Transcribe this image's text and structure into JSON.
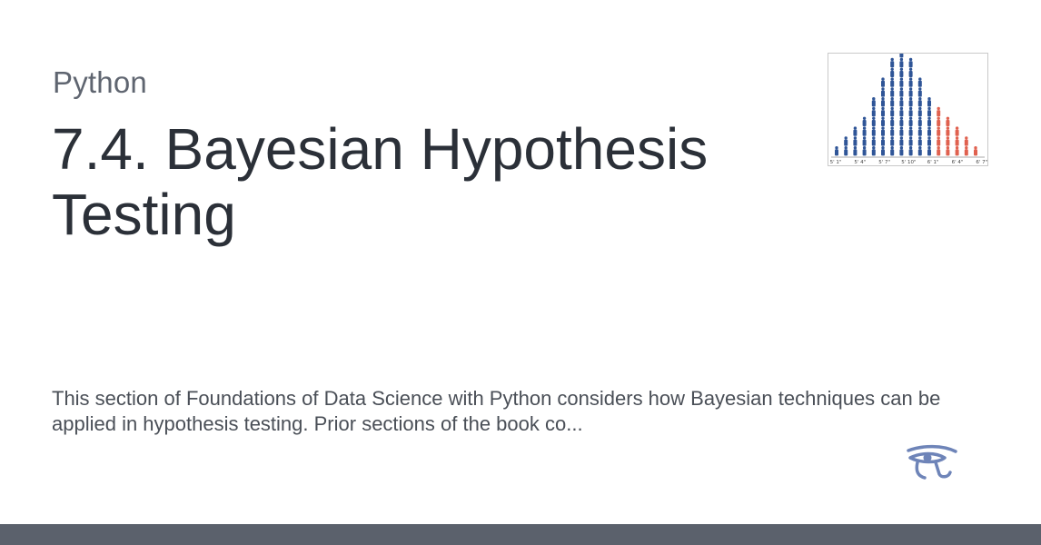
{
  "category": "Python",
  "title": "7.4. Bayesian Hypothesis Testing",
  "description": "This section of Foundations of Data Science with Python considers how Bayesian techniques can be applied in hypothesis testing. Prior sections of the book co...",
  "thumbnail": {
    "axis_labels": [
      "5' 1\"",
      "5' 4\"",
      "5' 7\"",
      "5' 10\"",
      "6' 1\"",
      "6' 4\"",
      "6' 7\""
    ],
    "column_counts": [
      1,
      2,
      3,
      4,
      6,
      8,
      10,
      11,
      10,
      8,
      6,
      5,
      4,
      3,
      2,
      1
    ],
    "highlight_from_column": 11,
    "colors": {
      "primary": "#2f5597",
      "highlight": "#e0614f"
    }
  },
  "logo": {
    "icon": "eye-of-horus-icon",
    "color": "#6e84b8"
  },
  "footer": {
    "color": "#5b616c"
  }
}
